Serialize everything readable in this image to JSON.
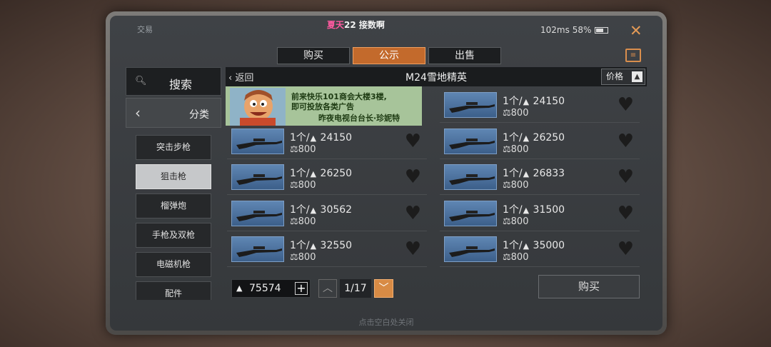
{
  "window": {
    "app_title": "交易",
    "announce_highlight": "夏天",
    "announce_rest": "22 接数啊",
    "ping": "102ms",
    "battery": "58%"
  },
  "tabs": [
    {
      "label": "购买"
    },
    {
      "label": "公示"
    },
    {
      "label": "出售"
    }
  ],
  "active_tab": "公示",
  "left": {
    "search_label": "搜索",
    "category_label": "分类"
  },
  "categories": [
    "突击步枪",
    "狙击枪",
    "榴弹炮",
    "手枪及双枪",
    "电磁机枪",
    "配件"
  ],
  "active_category": "狙击枪",
  "header": {
    "back_label": "返回",
    "title": "M24雪地精英",
    "sort_label": "价格"
  },
  "ad": {
    "line1": "前来快乐101商会大楼3楼,",
    "line2": "即可投放各类广告",
    "line3": "昨夜电视台台长·珍妮特"
  },
  "listings": [
    {
      "qty": "1个/",
      "price": "24150",
      "fee": "800"
    },
    {
      "qty": "1个/",
      "price": "24150",
      "fee": "800"
    },
    {
      "qty": "1个/",
      "price": "26250",
      "fee": "800"
    },
    {
      "qty": "1个/",
      "price": "26250",
      "fee": "800"
    },
    {
      "qty": "1个/",
      "price": "26833",
      "fee": "800"
    },
    {
      "qty": "1个/",
      "price": "30562",
      "fee": "800"
    },
    {
      "qty": "1个/",
      "price": "31500",
      "fee": "800"
    },
    {
      "qty": "1个/",
      "price": "32550",
      "fee": "800"
    },
    {
      "qty": "1个/",
      "price": "35000",
      "fee": "800"
    }
  ],
  "footer": {
    "balance": "75574",
    "page": "1/17",
    "buy_label": "购买",
    "close_hint": "点击空白处关闭"
  },
  "colors": {
    "accent": "#c36a2c",
    "thumb_bg": "#4f77a6"
  }
}
